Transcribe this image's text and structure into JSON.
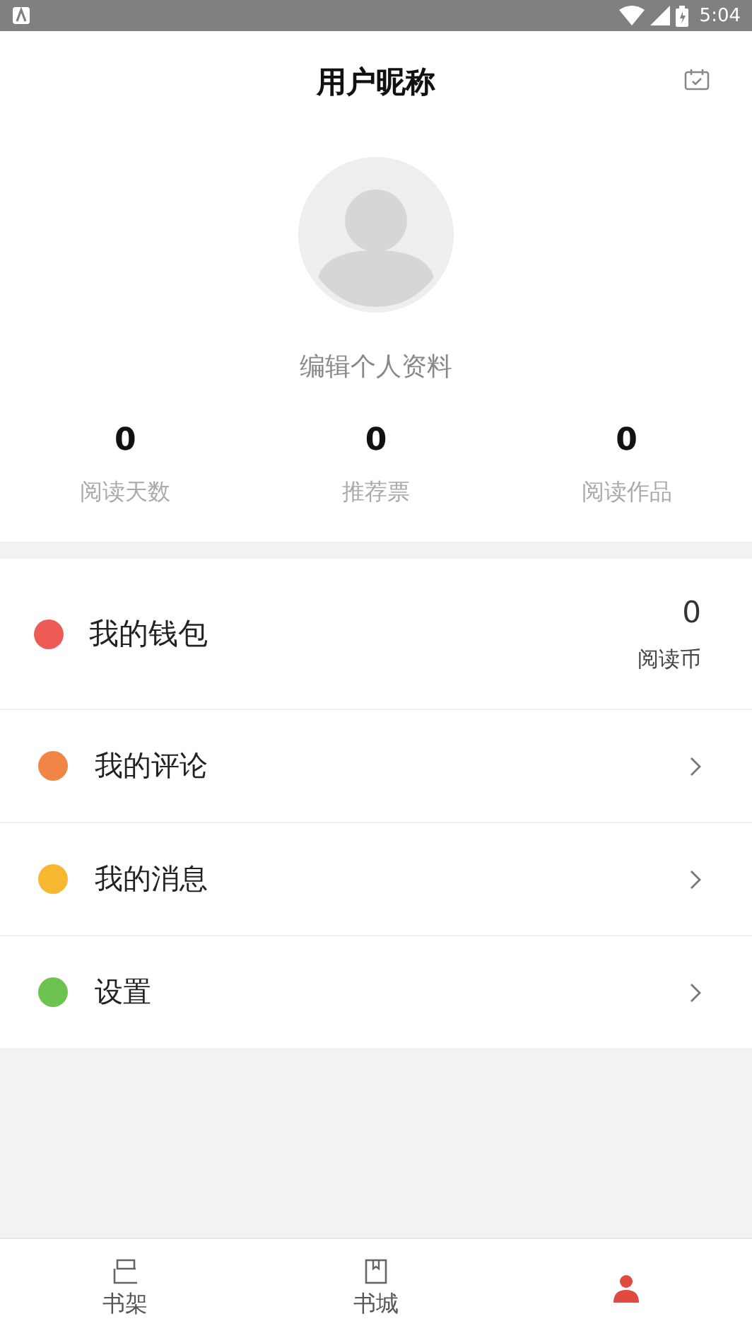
{
  "status_bar": {
    "time": "5:04"
  },
  "header": {
    "title": "用户昵称"
  },
  "profile": {
    "edit_link": "编辑个人资料"
  },
  "stats": [
    {
      "value": "0",
      "label": "阅读天数"
    },
    {
      "value": "0",
      "label": "推荐票"
    },
    {
      "value": "0",
      "label": "阅读作品"
    }
  ],
  "menu": [
    {
      "kind": "wallet",
      "label": "我的钱包",
      "color": "#ee5b55",
      "value": "0",
      "unit": "阅读币"
    },
    {
      "kind": "link",
      "label": "我的评论",
      "color": "#f08545"
    },
    {
      "kind": "link",
      "label": "我的消息",
      "color": "#f7b731"
    },
    {
      "kind": "link",
      "label": "设置",
      "color": "#6cc350"
    }
  ],
  "tabs": [
    {
      "kind": "shelf",
      "label": "书架",
      "selected": false
    },
    {
      "kind": "store",
      "label": "书城",
      "selected": false
    },
    {
      "kind": "me",
      "selected": true
    }
  ]
}
